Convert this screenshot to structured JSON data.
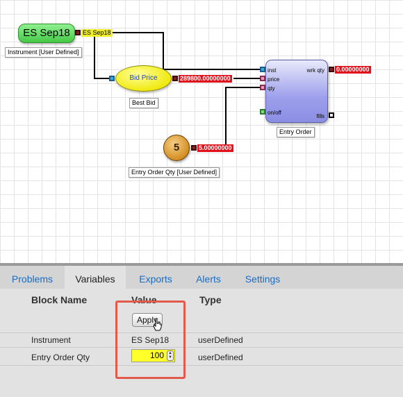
{
  "canvas": {
    "instrument_block": {
      "label": "ES Sep18",
      "output_value": "ES Sep18",
      "caption": "Instrument [User Defined]"
    },
    "bid_block": {
      "label": "Bid Price",
      "output_value": "289800.00000000",
      "caption": "Best Bid"
    },
    "qty_block": {
      "label": "5",
      "output_value": "5.00000000",
      "caption": "Entry Order Qty [User Defined]"
    },
    "entry_order_block": {
      "caption": "Entry Order",
      "inputs": [
        "inst",
        "price",
        "qty",
        "on/off"
      ],
      "outputs": [
        "wrk qty",
        "fills"
      ],
      "wrk_qty_value": "0.00000000"
    }
  },
  "tabs": [
    "Problems",
    "Variables",
    "Exports",
    "Alerts",
    "Settings"
  ],
  "active_tab": "Variables",
  "variables_table": {
    "headers": [
      "Block Name",
      "Value",
      "Type"
    ],
    "apply_label": "Apply",
    "rows": [
      {
        "block_name": "Instrument",
        "value": "ES Sep18",
        "type": "userDefined"
      },
      {
        "block_name": "Entry Order Qty",
        "value": "100",
        "type": "userDefined"
      }
    ]
  },
  "colors": {
    "highlight": "#e25a4a",
    "value_tag": "#e0121b",
    "link": "#1a6bc4",
    "input_bg": "#ffff2a"
  }
}
